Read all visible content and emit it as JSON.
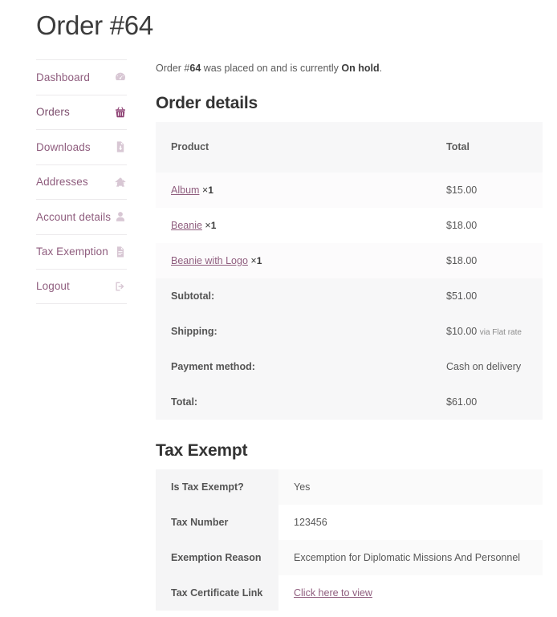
{
  "page": {
    "title": "Order #64"
  },
  "sidebar": {
    "items": [
      {
        "label": "Dashboard",
        "icon": "gauge-icon",
        "active": false
      },
      {
        "label": "Orders",
        "icon": "basket-icon",
        "active": true
      },
      {
        "label": "Downloads",
        "icon": "download-icon",
        "active": false
      },
      {
        "label": "Addresses",
        "icon": "home-icon",
        "active": false
      },
      {
        "label": "Account details",
        "icon": "user-icon",
        "active": false
      },
      {
        "label": "Tax Exemption",
        "icon": "document-icon",
        "active": false
      },
      {
        "label": "Logout",
        "icon": "logout-icon",
        "active": false
      }
    ]
  },
  "main": {
    "intro": {
      "prefix": "Order #",
      "order_number": "64",
      "middle": " was placed on  and is currently ",
      "status": "On hold",
      "suffix": "."
    },
    "order_details": {
      "heading": "Order details",
      "columns": {
        "product": "Product",
        "total": "Total"
      },
      "items": [
        {
          "name": "Album",
          "times": "×",
          "qty": "1",
          "total": "$15.00"
        },
        {
          "name": "Beanie",
          "times": "×",
          "qty": "1",
          "total": "$18.00"
        },
        {
          "name": "Beanie with Logo",
          "times": "×",
          "qty": "1",
          "total": "$18.00"
        }
      ],
      "totals": [
        {
          "label": "Subtotal:",
          "value": "$51.00",
          "note": ""
        },
        {
          "label": "Shipping:",
          "value": "$10.00",
          "note": "via Flat rate"
        },
        {
          "label": "Payment method:",
          "value": "Cash on delivery",
          "note": ""
        },
        {
          "label": "Total:",
          "value": "$61.00",
          "note": ""
        }
      ]
    },
    "tax_exempt": {
      "heading": "Tax Exempt",
      "rows": [
        {
          "label": "Is Tax Exempt?",
          "value": "Yes",
          "is_link": false
        },
        {
          "label": "Tax Number",
          "value": "123456",
          "is_link": false
        },
        {
          "label": "Exemption Reason",
          "value": "Excemption for Diplomatic Missions And Personnel",
          "is_link": false
        },
        {
          "label": "Tax Certificate Link",
          "value": "Click here to view",
          "is_link": true
        }
      ]
    }
  },
  "colors": {
    "link_purple": "#8f5d7e",
    "active_purple": "#8c3f72",
    "icon_inactive": "#d8c7d4",
    "heading_dark": "#333333",
    "table_header_bg": "#f7f7f8"
  }
}
